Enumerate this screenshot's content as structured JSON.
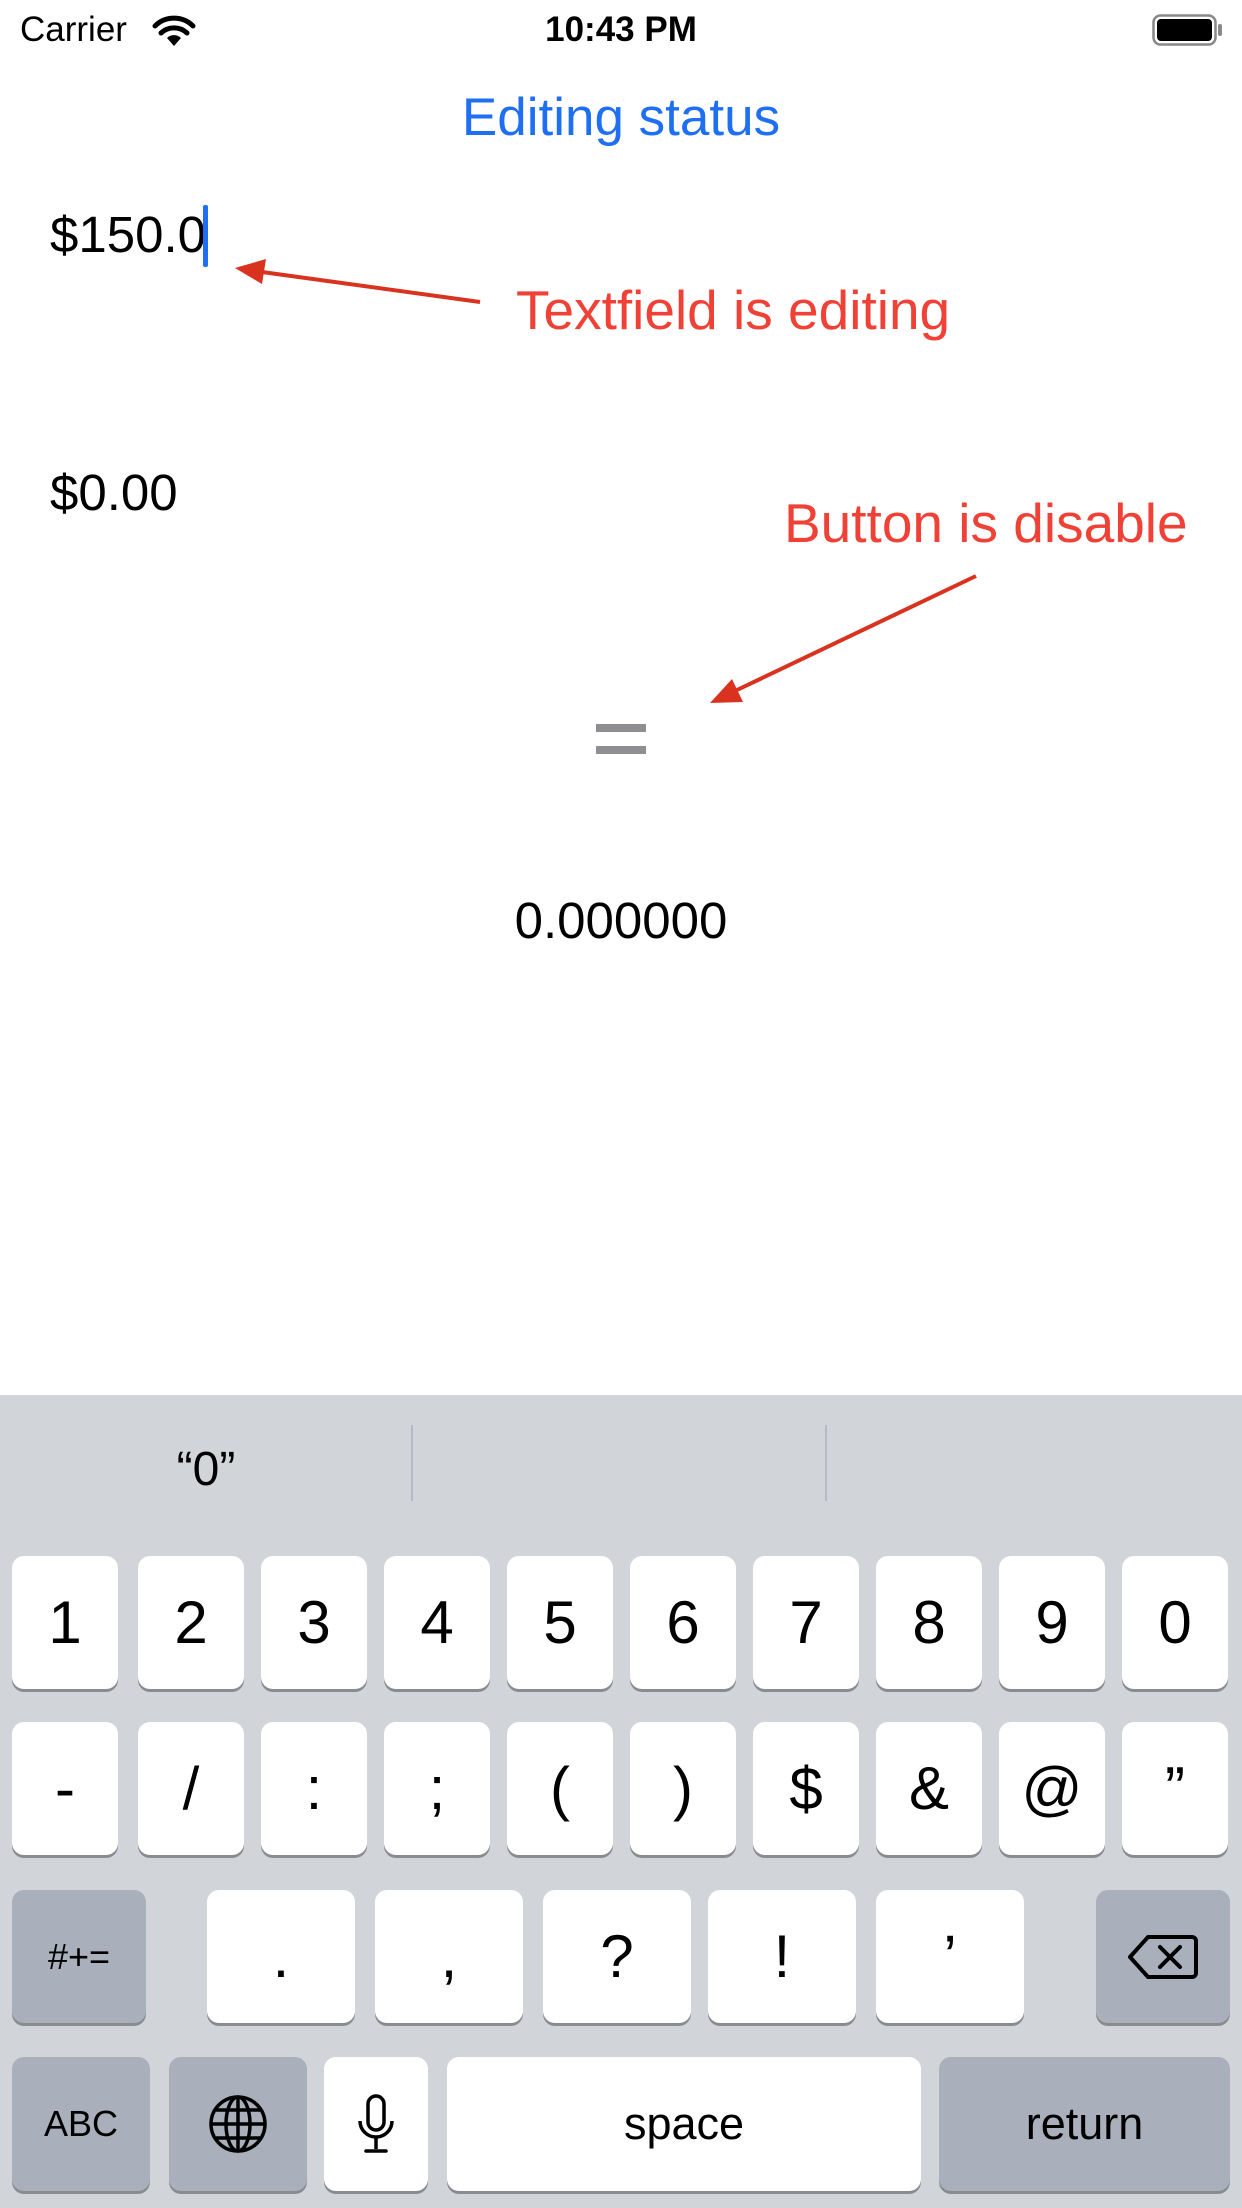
{
  "status_bar": {
    "carrier": "Carrier",
    "time": "10:43 PM",
    "icons": [
      "wifi-icon",
      "battery-icon"
    ]
  },
  "title": "Editing status",
  "field1": {
    "value": "$150.0"
  },
  "field2": {
    "value": "$0.00"
  },
  "annotations": {
    "editing": "Textfield is editing",
    "disabled": "Button is disable"
  },
  "equals_button": {
    "label": "="
  },
  "result": "0.000000",
  "keyboard": {
    "suggestions": [
      "“0”",
      "",
      ""
    ],
    "row1": [
      "1",
      "2",
      "3",
      "4",
      "5",
      "6",
      "7",
      "8",
      "9",
      "0"
    ],
    "row2": [
      "-",
      "/",
      ":",
      ";",
      "(",
      ")",
      "$",
      "&",
      "@",
      "”"
    ],
    "row3": [
      "#+=",
      ".",
      ",",
      "?",
      "!",
      "’"
    ],
    "abc": "ABC",
    "space": "space",
    "return": "return",
    "icons": [
      "globe-icon",
      "microphone-icon",
      "backspace-icon"
    ]
  },
  "colors": {
    "accent": "#1f6ff2",
    "annotation": "#ef4136",
    "keyboard_bg": "#d1d4d9",
    "dark_key": "#a9b0bb",
    "disabled": "#8e8e93"
  }
}
